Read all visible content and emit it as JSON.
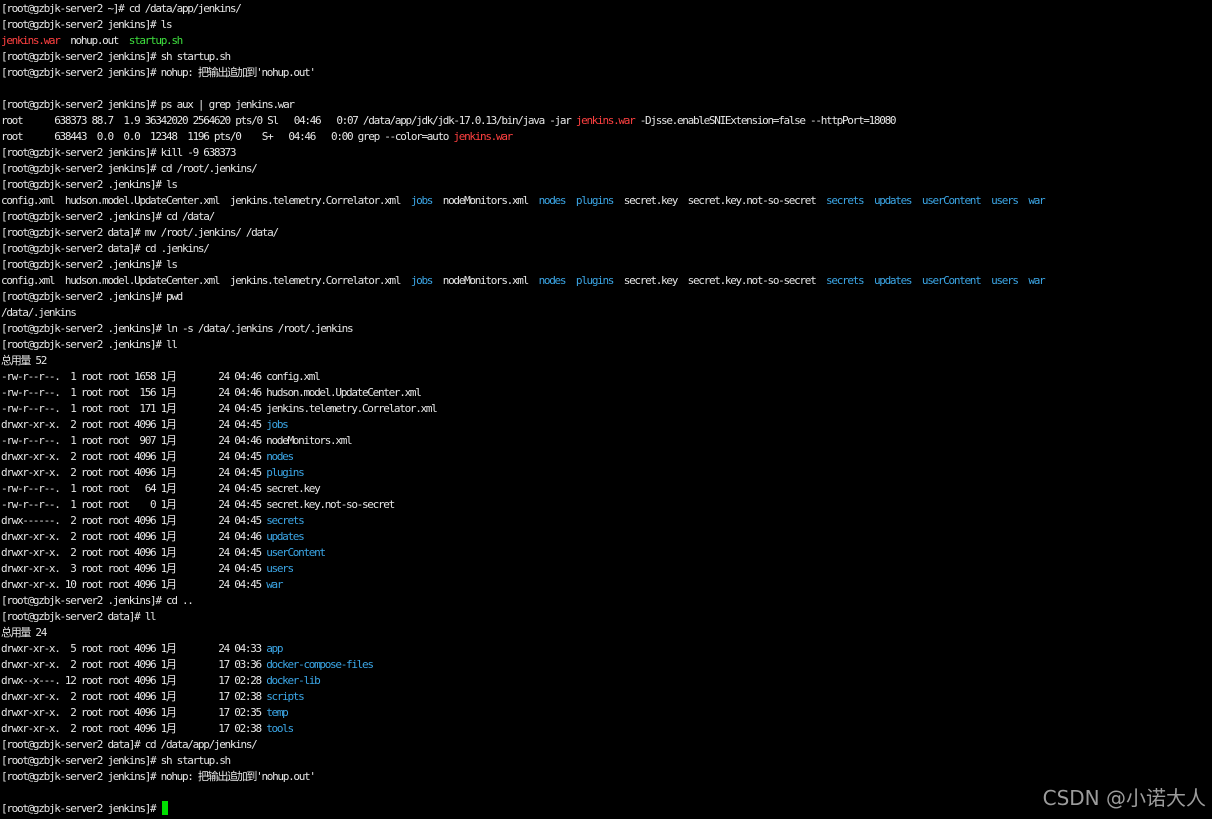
{
  "colors": {
    "default": "#e6e6e6",
    "red": "#ff4040",
    "green": "#3ee03e",
    "blue": "#3ba6e6",
    "cursor": "#00e000"
  },
  "watermark": "CSDN @小诺大人",
  "lines": [
    {
      "segs": [
        {
          "t": "[root@gzbjk-server2 ~]# cd /data/app/jenkins/"
        }
      ]
    },
    {
      "segs": [
        {
          "t": "[root@gzbjk-server2 jenkins]# ls"
        }
      ]
    },
    {
      "segs": [
        {
          "t": "jenkins.war",
          "c": "red"
        },
        {
          "t": "  nohup.out  "
        },
        {
          "t": "startup.sh",
          "c": "green"
        }
      ]
    },
    {
      "segs": [
        {
          "t": "[root@gzbjk-server2 jenkins]# sh startup.sh"
        }
      ]
    },
    {
      "segs": [
        {
          "t": "[root@gzbjk-server2 jenkins]# nohup: 把输出追加到'nohup.out'"
        }
      ]
    },
    {
      "segs": []
    },
    {
      "segs": [
        {
          "t": "[root@gzbjk-server2 jenkins]# ps aux | grep jenkins.war"
        }
      ]
    },
    {
      "segs": [
        {
          "t": "root      638373 88.7  1.9 36342020 2564620 pts/0 Sl   04:46   0:07 /data/app/jdk/jdk-17.0.13/bin/java -jar "
        },
        {
          "t": "jenkins.war",
          "c": "red"
        },
        {
          "t": " -Djsse.enableSNIExtension=false --httpPort=18080"
        }
      ]
    },
    {
      "segs": [
        {
          "t": "root      638443  0.0  0.0  12348  1196 pts/0    S+   04:46   0:00 grep --color=auto "
        },
        {
          "t": "jenkins.war",
          "c": "red"
        }
      ]
    },
    {
      "segs": [
        {
          "t": "[root@gzbjk-server2 jenkins]# kill -9 638373"
        }
      ]
    },
    {
      "segs": [
        {
          "t": "[root@gzbjk-server2 jenkins]# cd /root/.jenkins/"
        }
      ]
    },
    {
      "segs": [
        {
          "t": "[root@gzbjk-server2 .jenkins]# ls"
        }
      ]
    },
    {
      "segs": [
        {
          "t": "config.xml  hudson.model.UpdateCenter.xml  jenkins.telemetry.Correlator.xml  "
        },
        {
          "t": "jobs",
          "c": "blue"
        },
        {
          "t": "  nodeMonitors.xml  "
        },
        {
          "t": "nodes",
          "c": "blue"
        },
        {
          "t": "  "
        },
        {
          "t": "plugins",
          "c": "blue"
        },
        {
          "t": "  secret.key  secret.key.not-so-secret  "
        },
        {
          "t": "secrets",
          "c": "blue"
        },
        {
          "t": "  "
        },
        {
          "t": "updates",
          "c": "blue"
        },
        {
          "t": "  "
        },
        {
          "t": "userContent",
          "c": "blue"
        },
        {
          "t": "  "
        },
        {
          "t": "users",
          "c": "blue"
        },
        {
          "t": "  "
        },
        {
          "t": "war",
          "c": "blue"
        }
      ]
    },
    {
      "segs": [
        {
          "t": "[root@gzbjk-server2 .jenkins]# cd /data/"
        }
      ]
    },
    {
      "segs": [
        {
          "t": "[root@gzbjk-server2 data]# mv /root/.jenkins/ /data/"
        }
      ]
    },
    {
      "segs": [
        {
          "t": "[root@gzbjk-server2 data]# cd .jenkins/"
        }
      ]
    },
    {
      "segs": [
        {
          "t": "[root@gzbjk-server2 .jenkins]# ls"
        }
      ]
    },
    {
      "segs": [
        {
          "t": "config.xml  hudson.model.UpdateCenter.xml  jenkins.telemetry.Correlator.xml  "
        },
        {
          "t": "jobs",
          "c": "blue"
        },
        {
          "t": "  nodeMonitors.xml  "
        },
        {
          "t": "nodes",
          "c": "blue"
        },
        {
          "t": "  "
        },
        {
          "t": "plugins",
          "c": "blue"
        },
        {
          "t": "  secret.key  secret.key.not-so-secret  "
        },
        {
          "t": "secrets",
          "c": "blue"
        },
        {
          "t": "  "
        },
        {
          "t": "updates",
          "c": "blue"
        },
        {
          "t": "  "
        },
        {
          "t": "userContent",
          "c": "blue"
        },
        {
          "t": "  "
        },
        {
          "t": "users",
          "c": "blue"
        },
        {
          "t": "  "
        },
        {
          "t": "war",
          "c": "blue"
        }
      ]
    },
    {
      "segs": [
        {
          "t": "[root@gzbjk-server2 .jenkins]# pwd"
        }
      ]
    },
    {
      "segs": [
        {
          "t": "/data/.jenkins"
        }
      ]
    },
    {
      "segs": [
        {
          "t": "[root@gzbjk-server2 .jenkins]# ln -s /data/.jenkins /root/.jenkins"
        }
      ]
    },
    {
      "segs": [
        {
          "t": "[root@gzbjk-server2 .jenkins]# ll"
        }
      ]
    },
    {
      "segs": [
        {
          "t": "总用量 52"
        }
      ]
    },
    {
      "segs": [
        {
          "t": "-rw-r--r--.  1 root root 1658 1月        24 04:46 config.xml"
        }
      ]
    },
    {
      "segs": [
        {
          "t": "-rw-r--r--.  1 root root  156 1月        24 04:46 hudson.model.UpdateCenter.xml"
        }
      ]
    },
    {
      "segs": [
        {
          "t": "-rw-r--r--.  1 root root  171 1月        24 04:45 jenkins.telemetry.Correlator.xml"
        }
      ]
    },
    {
      "segs": [
        {
          "t": "drwxr-xr-x.  2 root root 4096 1月        24 04:45 "
        },
        {
          "t": "jobs",
          "c": "blue"
        }
      ]
    },
    {
      "segs": [
        {
          "t": "-rw-r--r--.  1 root root  907 1月        24 04:46 nodeMonitors.xml"
        }
      ]
    },
    {
      "segs": [
        {
          "t": "drwxr-xr-x.  2 root root 4096 1月        24 04:45 "
        },
        {
          "t": "nodes",
          "c": "blue"
        }
      ]
    },
    {
      "segs": [
        {
          "t": "drwxr-xr-x.  2 root root 4096 1月        24 04:45 "
        },
        {
          "t": "plugins",
          "c": "blue"
        }
      ]
    },
    {
      "segs": [
        {
          "t": "-rw-r--r--.  1 root root   64 1月        24 04:45 secret.key"
        }
      ]
    },
    {
      "segs": [
        {
          "t": "-rw-r--r--.  1 root root    0 1月        24 04:45 secret.key.not-so-secret"
        }
      ]
    },
    {
      "segs": [
        {
          "t": "drwx------.  2 root root 4096 1月        24 04:45 "
        },
        {
          "t": "secrets",
          "c": "blue"
        }
      ]
    },
    {
      "segs": [
        {
          "t": "drwxr-xr-x.  2 root root 4096 1月        24 04:46 "
        },
        {
          "t": "updates",
          "c": "blue"
        }
      ]
    },
    {
      "segs": [
        {
          "t": "drwxr-xr-x.  2 root root 4096 1月        24 04:45 "
        },
        {
          "t": "userContent",
          "c": "blue"
        }
      ]
    },
    {
      "segs": [
        {
          "t": "drwxr-xr-x.  3 root root 4096 1月        24 04:45 "
        },
        {
          "t": "users",
          "c": "blue"
        }
      ]
    },
    {
      "segs": [
        {
          "t": "drwxr-xr-x. 10 root root 4096 1月        24 04:45 "
        },
        {
          "t": "war",
          "c": "blue"
        }
      ]
    },
    {
      "segs": [
        {
          "t": "[root@gzbjk-server2 .jenkins]# cd .."
        }
      ]
    },
    {
      "segs": [
        {
          "t": "[root@gzbjk-server2 data]# ll"
        }
      ]
    },
    {
      "segs": [
        {
          "t": "总用量 24"
        }
      ]
    },
    {
      "segs": [
        {
          "t": "drwxr-xr-x.  5 root root 4096 1月        24 04:33 "
        },
        {
          "t": "app",
          "c": "blue"
        }
      ]
    },
    {
      "segs": [
        {
          "t": "drwxr-xr-x.  2 root root 4096 1月        17 03:36 "
        },
        {
          "t": "docker-compose-files",
          "c": "blue"
        }
      ]
    },
    {
      "segs": [
        {
          "t": "drwx--x---. 12 root root 4096 1月        17 02:28 "
        },
        {
          "t": "docker-lib",
          "c": "blue"
        }
      ]
    },
    {
      "segs": [
        {
          "t": "drwxr-xr-x.  2 root root 4096 1月        17 02:38 "
        },
        {
          "t": "scripts",
          "c": "blue"
        }
      ]
    },
    {
      "segs": [
        {
          "t": "drwxr-xr-x.  2 root root 4096 1月        17 02:35 "
        },
        {
          "t": "temp",
          "c": "blue"
        }
      ]
    },
    {
      "segs": [
        {
          "t": "drwxr-xr-x.  2 root root 4096 1月        17 02:38 "
        },
        {
          "t": "tools",
          "c": "blue"
        }
      ]
    },
    {
      "segs": [
        {
          "t": "[root@gzbjk-server2 data]# cd /data/app/jenkins/"
        }
      ]
    },
    {
      "segs": [
        {
          "t": "[root@gzbjk-server2 jenkins]# sh startup.sh"
        }
      ]
    },
    {
      "segs": [
        {
          "t": "[root@gzbjk-server2 jenkins]# nohup: 把输出追加到'nohup.out'"
        }
      ]
    },
    {
      "segs": []
    },
    {
      "segs": [
        {
          "t": "[root@gzbjk-server2 jenkins]# "
        }
      ],
      "cursor": true
    }
  ]
}
